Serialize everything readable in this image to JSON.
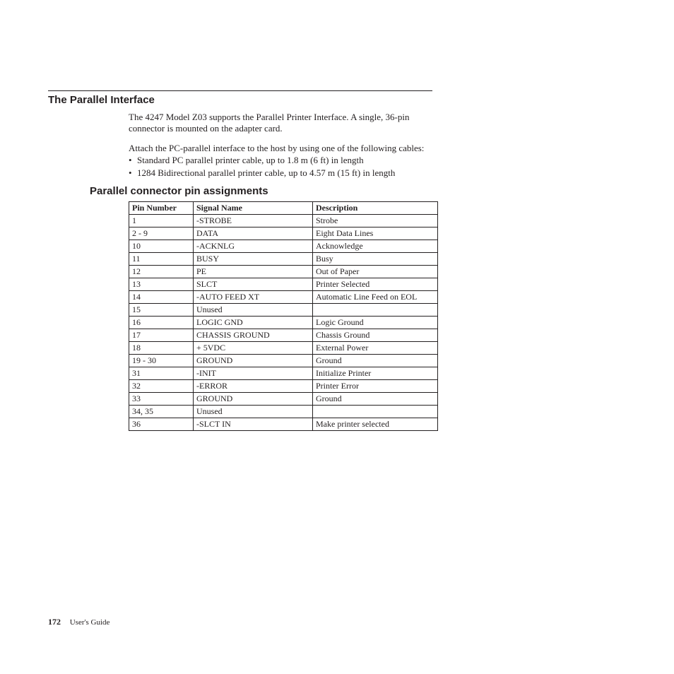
{
  "heading1": "The Parallel Interface",
  "paragraph1": "The 4247 Model Z03 supports the Parallel Printer Interface. A single, 36-pin connector is mounted on the adapter card.",
  "paragraph2": "Attach the PC-parallel interface to the host by using one of the following cables:",
  "bullets": [
    "Standard PC parallel printer cable, up to 1.8 m (6 ft) in length",
    "1284 Bidirectional parallel printer cable, up to 4.57 m (15 ft) in length"
  ],
  "heading2": "Parallel connector pin assignments",
  "table": {
    "headers": [
      "Pin Number",
      "Signal Name",
      "Description"
    ],
    "rows": [
      [
        "1",
        "-STROBE",
        "Strobe"
      ],
      [
        "2 - 9",
        "DATA",
        "Eight Data Lines"
      ],
      [
        "10",
        "-ACKNLG",
        "Acknowledge"
      ],
      [
        "11",
        "BUSY",
        "Busy"
      ],
      [
        "12",
        "PE",
        "Out of Paper"
      ],
      [
        "13",
        "SLCT",
        "Printer Selected"
      ],
      [
        "14",
        "-AUTO FEED XT",
        "Automatic Line Feed on EOL"
      ],
      [
        "15",
        "Unused",
        ""
      ],
      [
        "16",
        "LOGIC GND",
        "Logic Ground"
      ],
      [
        "17",
        "CHASSIS GROUND",
        "Chassis Ground"
      ],
      [
        "18",
        "+ 5VDC",
        "External Power"
      ],
      [
        "19 - 30",
        "GROUND",
        "Ground"
      ],
      [
        "31",
        "-INIT",
        "Initialize Printer"
      ],
      [
        "32",
        "-ERROR",
        "Printer Error"
      ],
      [
        "33",
        "GROUND",
        "Ground"
      ],
      [
        "34, 35",
        "Unused",
        ""
      ],
      [
        "36",
        "-SLCT IN",
        "Make printer selected"
      ]
    ]
  },
  "footer": {
    "page_number": "172",
    "doc_title": "User's Guide"
  }
}
